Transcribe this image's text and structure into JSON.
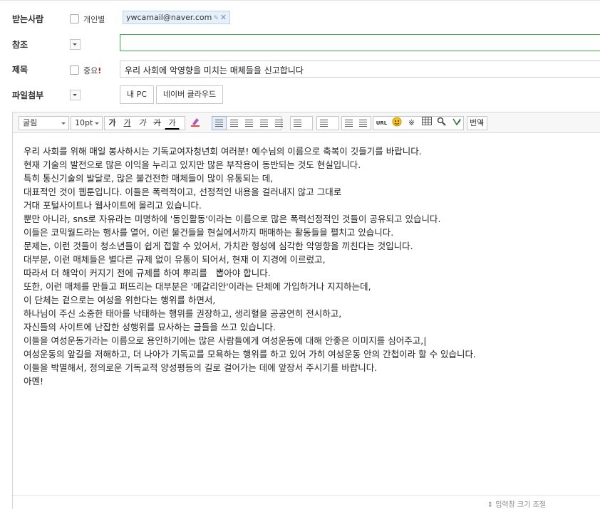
{
  "recipient": {
    "label": "받는사람",
    "individual_label": "개인별",
    "chip_email": "ywcamail@naver.com"
  },
  "cc": {
    "label": "참조",
    "value": ""
  },
  "subject": {
    "label": "제목",
    "important_label": "중요",
    "important_mark": "!",
    "value": "우리 사회에 악영향을 미치는 매체들을 신고합니다"
  },
  "attachment": {
    "label": "파일첨부",
    "my_pc_button": "내 PC",
    "cloud_button": "네이버 클라우드"
  },
  "toolbar": {
    "font_family": "굴림",
    "font_size": "10pt",
    "bold": "가",
    "underline": "가",
    "italic": "가",
    "strike": "가",
    "font_color": "가",
    "translate": "번역",
    "url": "URL"
  },
  "body_lines": [
    "우리 사회를 위해 매일 봉사하시는 기독교여자청년회 여러분! 예수님의 이름으로 축복이 깃들기를 바랍니다.",
    "현재 기술의 발전으로 많은 이익을 누리고 있지만 많은 부작용이 동반되는 것도 현실입니다.",
    "특히 통신기술의 발달로, 많은 불건전한 매체들이 많이 유통되는 데,",
    "대표적인 것이 웹툰입니다. 이들은 폭력적이고, 선정적인 내용을 걸러내지 않고 그대로",
    "거대 포털사이트나 웹사이트에 올리고 있습니다.",
    "뿐만 아니라, sns로 자유라는 미명하에 '동인활동'이라는 이름으로 많은 폭력선정적인 것들이 공유되고 있습니다.",
    "이들은 코믹월드라는 행사를 열어, 이런 물건들을 현실에서까지 매매하는 활동들을 펼치고 있습니다.",
    "문제는, 이런 것들이 청소년들이 쉽게 접할 수 있어서, 가치관 형성에 심각한 악영향을 끼친다는 것입니다.",
    "대부분, 이런 매체들은 별다른 규제 없이 유통이 되어서, 현재 이 지경에 이르렀고,",
    "따라서 더 해악이 커지기 전에 규제를 하여 뿌리를   뽑아야 합니다.",
    "또한, 이런 매체를 만들고 퍼뜨리는 대부분은 '메갈리안'이라는 단체에 가입하거나 지지하는데,",
    "이 단체는 겉으로는 여성을 위한다는 행위를 하면서,",
    "하나님이 주신 소중한 태아를 낙태하는 행위를 권장하고, 생리혈을 공공연히 전시하고,",
    "자신들의 사이트에 난잡한 성행위를 묘사하는 글들을 쓰고 있습니다.",
    "이들을 여성운동가라는 이름으로 용인하기에는 많은 사람들에게 여성운동에 대해 안좋은 이미지를 심어주고,|",
    "여성운동의 앞길을 저해하고, 더 나아가 기독교를 모욕하는 행위를 하고 있어 가히 여성운동 안의 간첩이라 할 수 있습니다.",
    "이들을 박멸해서, 정의로운 기독교적 양성평등의 길로 걸어가는 데에 앞장서 주시기를 바랍니다.",
    "아멘!"
  ],
  "resize_label": "⇕ 입력창 크기 조절"
}
